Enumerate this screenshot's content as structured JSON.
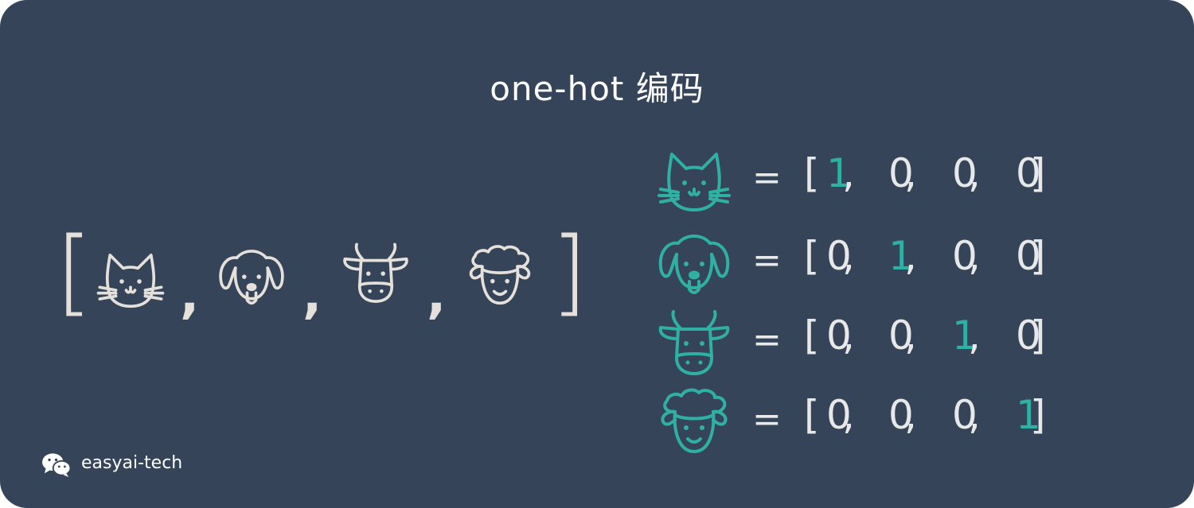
{
  "title": "one-hot 编码",
  "sequence": {
    "open_bracket": "[",
    "close_bracket": "]",
    "separator": ",",
    "items": [
      "cat-icon",
      "dog-icon",
      "cow-icon",
      "sheep-icon"
    ]
  },
  "encodings": [
    {
      "icon": "cat-icon",
      "equals": "=",
      "vector": [
        "1",
        "0",
        "0",
        "0"
      ],
      "hot_index": 0
    },
    {
      "icon": "dog-icon",
      "equals": "=",
      "vector": [
        "0",
        "1",
        "0",
        "0"
      ],
      "hot_index": 1
    },
    {
      "icon": "cow-icon",
      "equals": "=",
      "vector": [
        "0",
        "0",
        "1",
        "0"
      ],
      "hot_index": 2
    },
    {
      "icon": "sheep-icon",
      "equals": "=",
      "vector": [
        "0",
        "0",
        "0",
        "1"
      ],
      "hot_index": 3
    }
  ],
  "footer": {
    "icon": "wechat-icon",
    "brand": "easyai-tech"
  },
  "colors": {
    "background": "#354459",
    "accent": "#2fb0a3",
    "light": "#e5e1da",
    "text": "#e8e8e8"
  }
}
